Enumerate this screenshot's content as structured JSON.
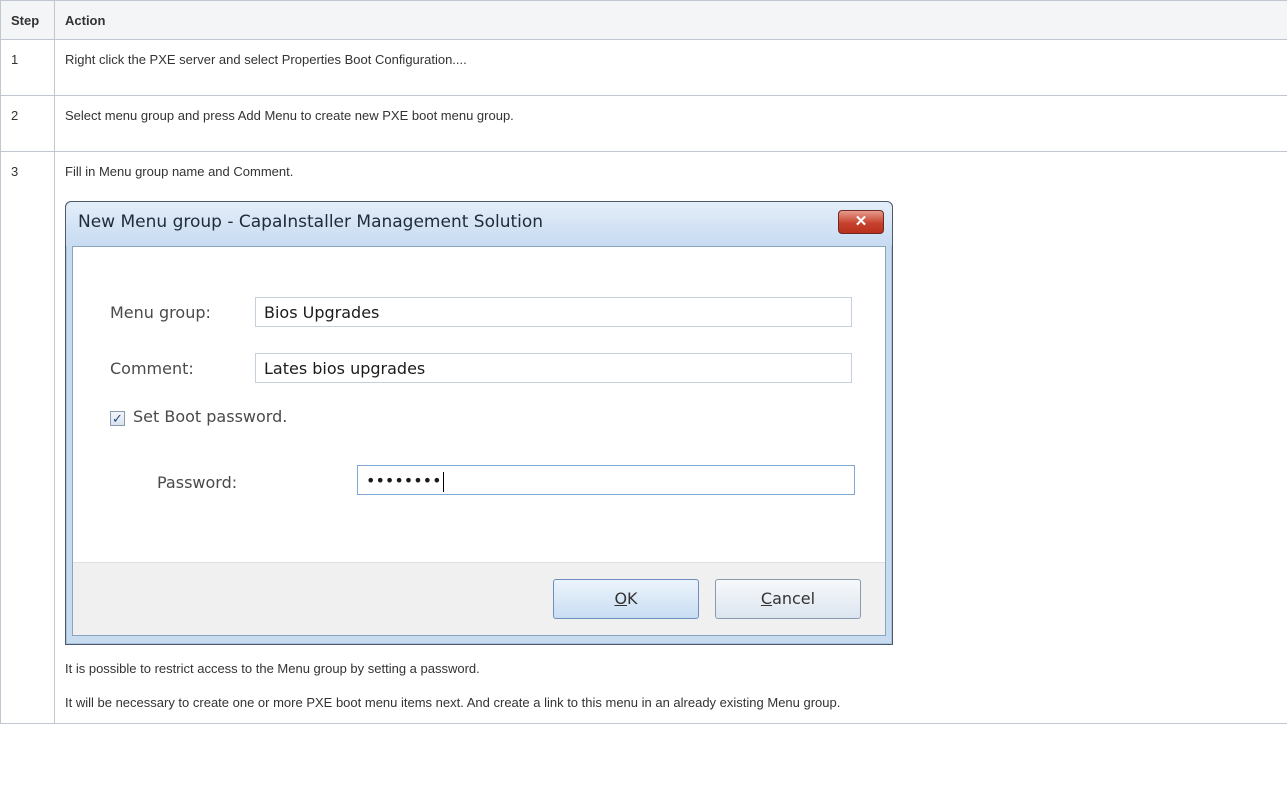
{
  "table": {
    "headers": {
      "step": "Step",
      "action": "Action"
    },
    "rows": [
      {
        "step": "1",
        "action": "Right click the PXE server and select Properties Boot Configuration...."
      },
      {
        "step": "2",
        "action": "Select menu group and press Add Menu to create new PXE boot menu group."
      },
      {
        "step": "3",
        "action": "Fill in Menu group name and  Comment."
      }
    ]
  },
  "dialog": {
    "title": "New Menu group - CapaInstaller Management Solution",
    "close_glyph": "✕",
    "menu_group_label": "Menu group:",
    "menu_group_value": "Bios Upgrades",
    "comment_label": "Comment:",
    "comment_value": "Lates bios upgrades",
    "set_boot_password_label": "Set Boot password.",
    "set_boot_password_checked": true,
    "password_label": "Password:",
    "password_value": "••••••••",
    "ok_label": "OK",
    "ok_mnemonic": "O",
    "ok_rest": "K",
    "cancel_label": "Cancel",
    "cancel_mnemonic": "C",
    "cancel_rest": "ancel"
  },
  "notes": {
    "para1": "It is possible to restrict access to the Menu group by setting a password.",
    "para2": "It will be necessary to create one or more PXE boot menu items next.  And create a link to this menu in an already existing Menu group."
  }
}
